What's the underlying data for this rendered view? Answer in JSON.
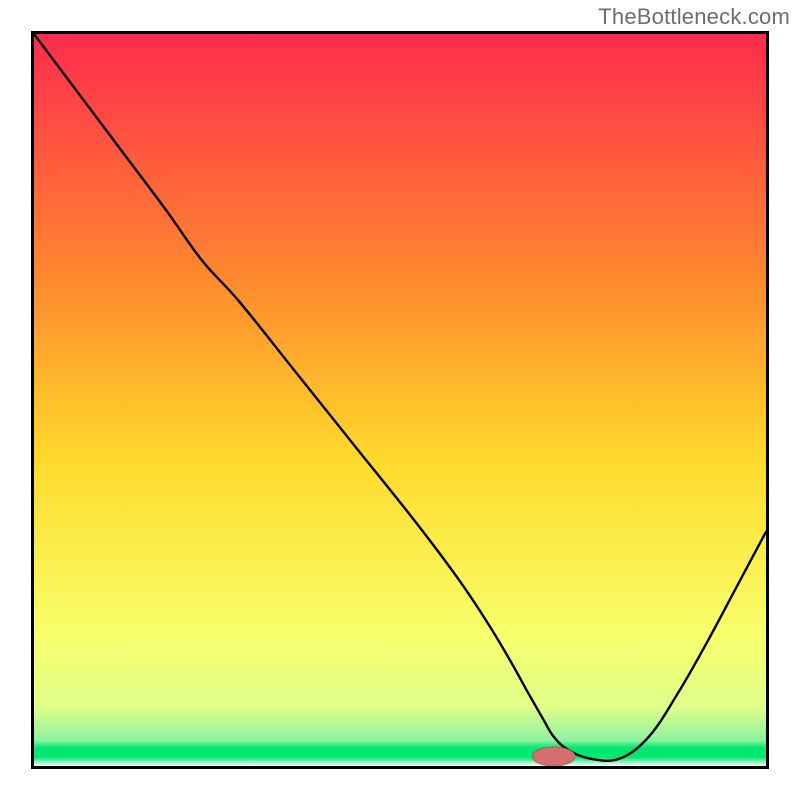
{
  "watermark": "TheBottleneck.com",
  "colors": {
    "gradient_top": "#ff2b4d",
    "gradient_upper_mid": "#ff8a2f",
    "gradient_mid": "#ffd92b",
    "gradient_lower_mid": "#f7ff6a",
    "gradient_low": "#dfff8a",
    "gradient_green_band": "#00e86f",
    "gradient_bottom_white": "#ffffff",
    "curve": "#000000",
    "marker_fill": "#d36f6f",
    "marker_stroke": "#bc5a5a",
    "frame": "#000000"
  },
  "chart_data": {
    "type": "line",
    "title": "",
    "xlabel": "",
    "ylabel": "",
    "xlim": [
      0,
      100
    ],
    "ylim": [
      0,
      100
    ],
    "x": [
      0,
      6,
      12,
      18,
      23,
      28,
      36,
      44,
      52,
      58,
      62,
      65,
      67.5,
      69.5,
      71,
      73,
      76,
      80,
      84,
      88,
      92,
      96,
      100
    ],
    "values": [
      100,
      92,
      84,
      76,
      69,
      63.5,
      53.5,
      43.5,
      33.5,
      25.5,
      19.5,
      14.5,
      10,
      6.5,
      4,
      2.2,
      1.0,
      1.0,
      4,
      10,
      17,
      24.5,
      32
    ],
    "marker": {
      "x": 71,
      "y": 1.3,
      "rx": 2.9,
      "ry": 1.3
    },
    "grid": false,
    "legend": false
  }
}
